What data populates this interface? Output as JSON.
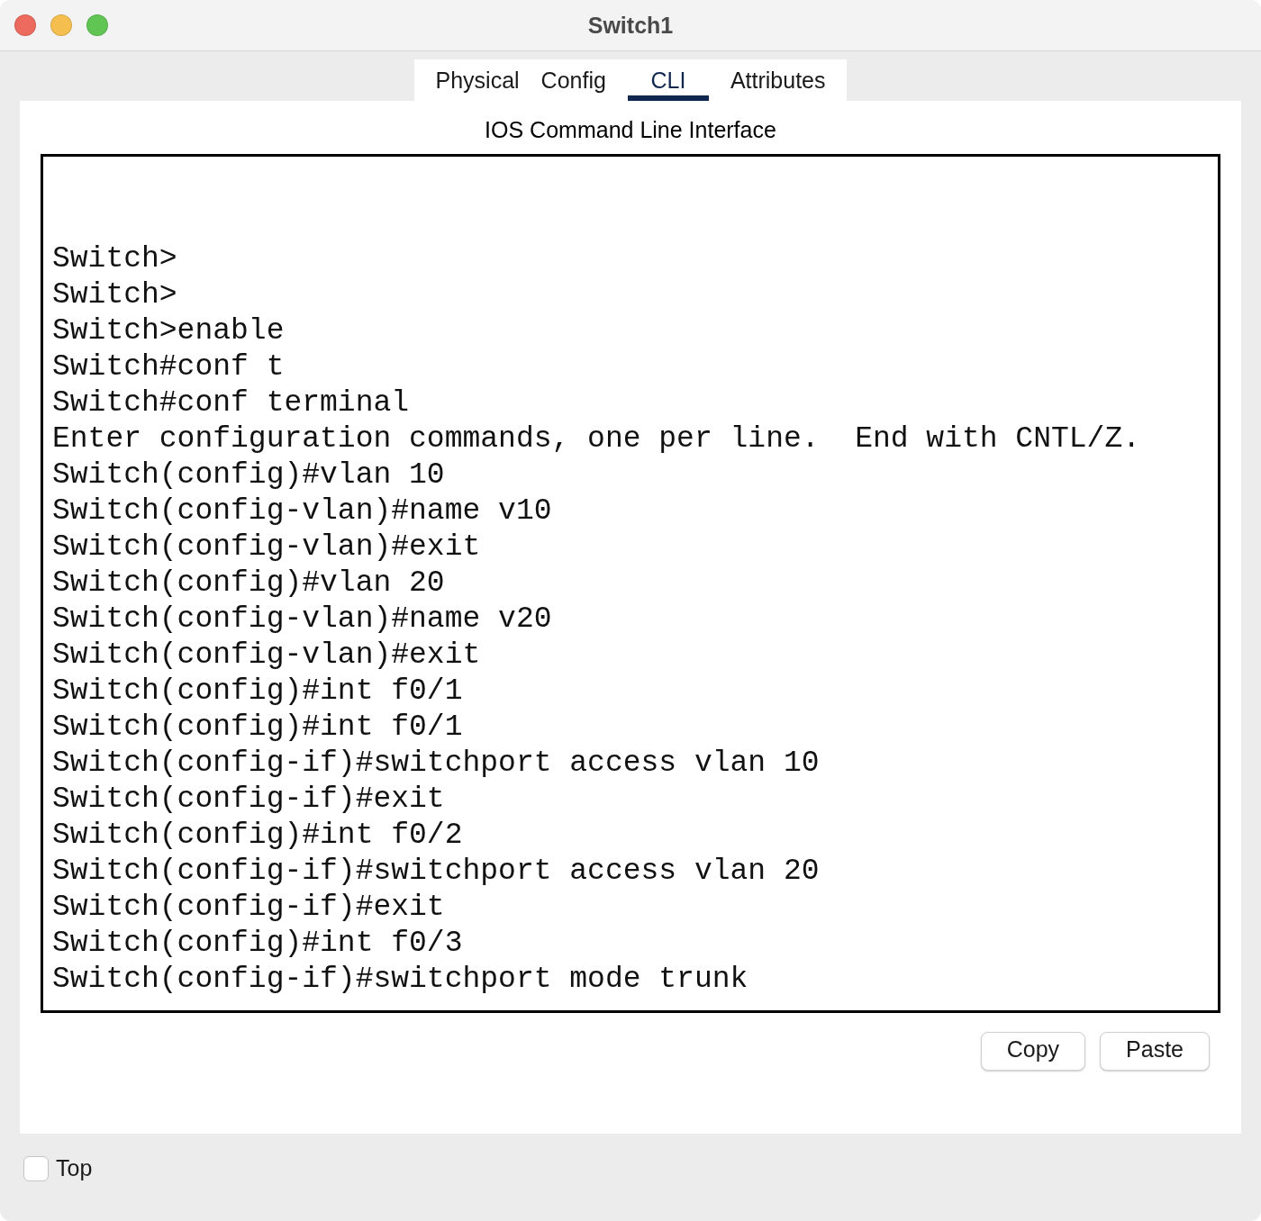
{
  "window": {
    "title": "Switch1"
  },
  "tabs": [
    {
      "label": "Physical",
      "selected": false
    },
    {
      "label": "Config",
      "selected": false
    },
    {
      "label": "CLI",
      "selected": true
    },
    {
      "label": "Attributes",
      "selected": false
    }
  ],
  "cli": {
    "heading": "IOS Command Line Interface",
    "lines": [
      "Switch>",
      "Switch>",
      "Switch>enable",
      "Switch#conf t",
      "Switch#conf terminal",
      "Enter configuration commands, one per line.  End with CNTL/Z.",
      "Switch(config)#vlan 10",
      "Switch(config-vlan)#name v10",
      "Switch(config-vlan)#exit",
      "Switch(config)#vlan 20",
      "Switch(config-vlan)#name v20",
      "Switch(config-vlan)#exit",
      "Switch(config)#int f0/1",
      "Switch(config)#int f0/1",
      "Switch(config-if)#switchport access vlan 10",
      "Switch(config-if)#exit",
      "Switch(config)#int f0/2",
      "Switch(config-if)#switchport access vlan 20",
      "Switch(config-if)#exit",
      "Switch(config)#int f0/3",
      "Switch(config-if)#switchport mode trunk"
    ]
  },
  "buttons": [
    "Copy",
    "Paste"
  ],
  "top_checkbox": {
    "label": "Top",
    "checked": false
  }
}
